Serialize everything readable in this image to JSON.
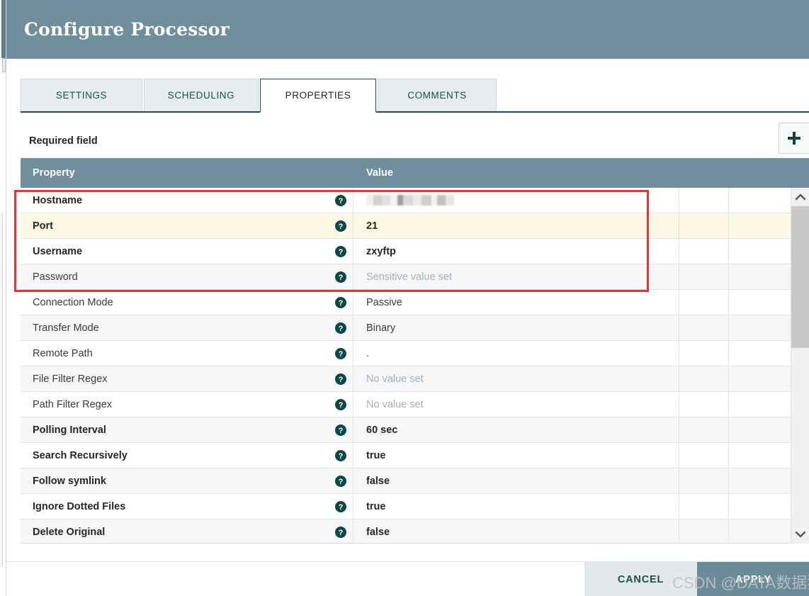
{
  "window": {
    "title": "Configure Processor",
    "header_bg": "#708e9b"
  },
  "tabs": [
    {
      "label": "SETTINGS",
      "active": false
    },
    {
      "label": "SCHEDULING",
      "active": false
    },
    {
      "label": "PROPERTIES",
      "active": true
    },
    {
      "label": "COMMENTS",
      "active": false
    }
  ],
  "toolbar": {
    "required_field_label": "Required field",
    "add_property_label": "+"
  },
  "table": {
    "columns": [
      "Property",
      "Value"
    ],
    "rows": [
      {
        "property": "Hostname",
        "value": "",
        "required": true,
        "redacted": true,
        "placeholder": false,
        "highlight": false
      },
      {
        "property": "Port",
        "value": "21",
        "required": true,
        "redacted": false,
        "placeholder": false,
        "highlight": true
      },
      {
        "property": "Username",
        "value": "zxyftp",
        "required": true,
        "redacted": false,
        "placeholder": false,
        "highlight": false
      },
      {
        "property": "Password",
        "value": "Sensitive value set",
        "required": false,
        "redacted": false,
        "placeholder": true,
        "highlight": false
      },
      {
        "property": "Connection Mode",
        "value": "Passive",
        "required": false,
        "redacted": false,
        "placeholder": false,
        "highlight": false
      },
      {
        "property": "Transfer Mode",
        "value": "Binary",
        "required": false,
        "redacted": false,
        "placeholder": false,
        "highlight": false
      },
      {
        "property": "Remote Path",
        "value": ".",
        "required": false,
        "redacted": false,
        "placeholder": false,
        "highlight": false
      },
      {
        "property": "File Filter Regex",
        "value": "No value set",
        "required": false,
        "redacted": false,
        "placeholder": true,
        "highlight": false
      },
      {
        "property": "Path Filter Regex",
        "value": "No value set",
        "required": false,
        "redacted": false,
        "placeholder": true,
        "highlight": false
      },
      {
        "property": "Polling Interval",
        "value": "60 sec",
        "required": true,
        "redacted": false,
        "placeholder": false,
        "highlight": false
      },
      {
        "property": "Search Recursively",
        "value": "true",
        "required": true,
        "redacted": false,
        "placeholder": false,
        "highlight": false
      },
      {
        "property": "Follow symlink",
        "value": "false",
        "required": true,
        "redacted": false,
        "placeholder": false,
        "highlight": false
      },
      {
        "property": "Ignore Dotted Files",
        "value": "true",
        "required": true,
        "redacted": false,
        "placeholder": false,
        "highlight": false
      },
      {
        "property": "Delete Original",
        "value": "false",
        "required": true,
        "redacted": false,
        "placeholder": false,
        "highlight": false
      }
    ]
  },
  "footer": {
    "cancel_label": "CANCEL",
    "apply_label": "APPLY"
  },
  "annotation": {
    "box_color": "#f42f2f"
  },
  "watermark": {
    "text": "CSDN @DATA数据猿"
  }
}
